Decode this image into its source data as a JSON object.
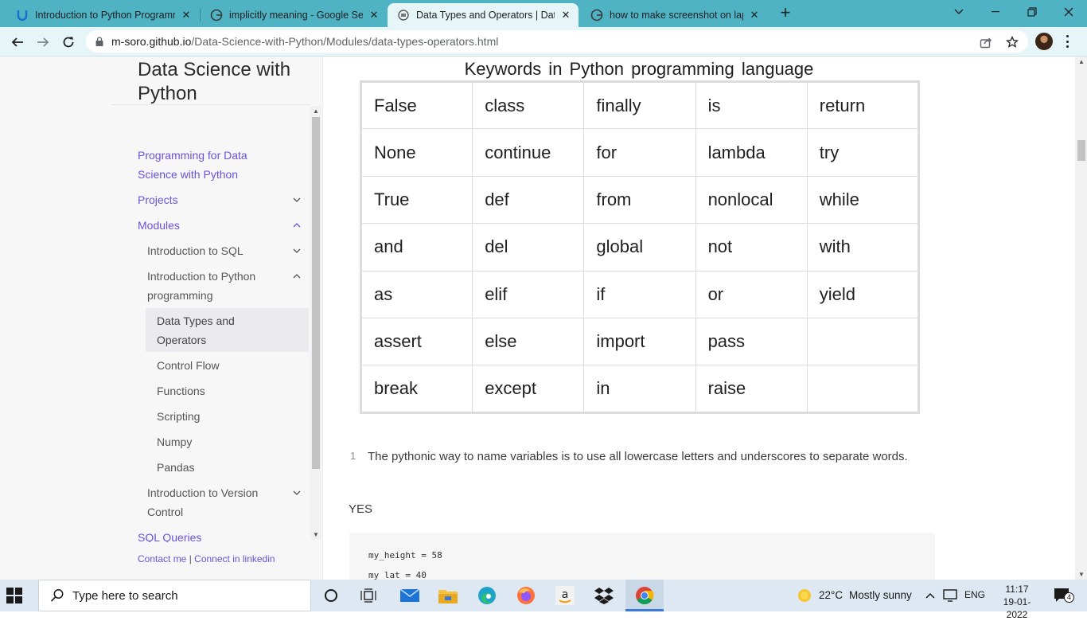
{
  "browser": {
    "tabs": [
      {
        "title": "Introduction to Python Programm",
        "icon": "udacity-icon",
        "active": false
      },
      {
        "title": "implicitly meaning - Google Sear",
        "icon": "google-icon",
        "active": false
      },
      {
        "title": "Data Types and Operators | Data",
        "icon": "page-icon",
        "active": true
      },
      {
        "title": "how to make screenshot on lapto",
        "icon": "google-icon",
        "active": false
      }
    ],
    "url_host": "m-soro.github.io",
    "url_path": "/Data-Science-with-Python/Modules/data-types-operators.html"
  },
  "sidebar": {
    "site_title": "Data Science with Python",
    "items": [
      {
        "label": "Programming for Data Science with Python"
      },
      {
        "label": "Projects"
      },
      {
        "label": "Modules"
      },
      {
        "label": "Introduction to SQL"
      },
      {
        "label": "Introduction to Python programming"
      },
      {
        "label": "Data Types and Operators"
      },
      {
        "label": "Control Flow"
      },
      {
        "label": "Functions"
      },
      {
        "label": "Scripting"
      },
      {
        "label": "Numpy"
      },
      {
        "label": "Pandas"
      },
      {
        "label": "Introduction to Version Control"
      },
      {
        "label": "SQL Queries"
      }
    ],
    "contact": {
      "contact_me": "Contact me",
      "separator": "|",
      "linkedin": "Connect in linkedin"
    }
  },
  "content": {
    "keywords_title": "Keywords in Python programming language",
    "keywords_rows": [
      [
        "False",
        "class",
        "finally",
        "is",
        "return"
      ],
      [
        "None",
        "continue",
        "for",
        "lambda",
        "try"
      ],
      [
        "True",
        "def",
        "from",
        "nonlocal",
        "while"
      ],
      [
        "and",
        "del",
        "global",
        "not",
        "with"
      ],
      [
        "as",
        "elif",
        "if",
        "or",
        "yield"
      ],
      [
        "assert",
        "else",
        "import",
        "pass",
        ""
      ],
      [
        "break",
        "except",
        "in",
        "raise",
        ""
      ]
    ],
    "footnote_number": "1",
    "footnote_text": "The pythonic way to name variables is to use all lowercase letters and underscores to separate words.",
    "yes_label": "YES",
    "code_lines": [
      "my_height = 58",
      "my_lat = 40"
    ]
  },
  "taskbar": {
    "search_placeholder": "Type here to search",
    "weather_temp": "22°C",
    "weather_text": "Mostly sunny",
    "language": "ENG",
    "time": "11:17",
    "date": "19-01-2022",
    "notification_count": "4"
  },
  "colors": {
    "tab_strip": "#4fb3c3",
    "toolbar": "#e6f6f8",
    "link": "#6b52d9",
    "sidebar_bg": "#f7f7f8"
  }
}
